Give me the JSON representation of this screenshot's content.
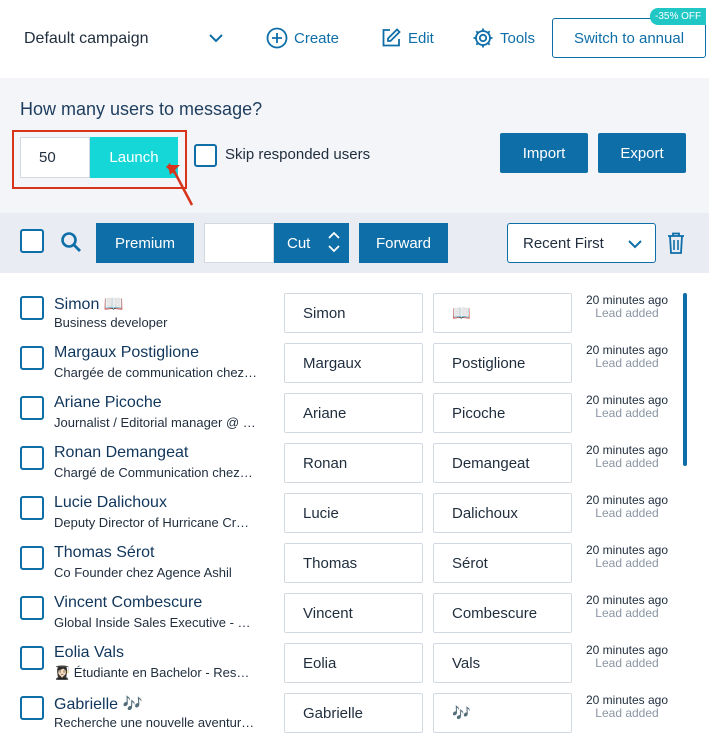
{
  "header": {
    "campaign": "Default campaign",
    "create_label": "Create",
    "edit_label": "Edit",
    "tools_label": "Tools",
    "switch_label": "Switch to annual",
    "discount_badge": "-35% OFF"
  },
  "launch": {
    "question": "How many users to message?",
    "count_value": "50",
    "launch_label": "Launch",
    "skip_label": "Skip responded users",
    "import_label": "Import",
    "export_label": "Export"
  },
  "toolbar": {
    "premium_label": "Premium",
    "cut_label": "Cut",
    "forward_label": "Forward",
    "sort_value": "Recent First"
  },
  "colors": {
    "primary": "#0e6ea8",
    "launch": "#15d7d8",
    "highlight": "#d8341b",
    "badge": "#20c7c4"
  },
  "leads": [
    {
      "name": "Simon 📖",
      "title": "Business developer",
      "first": "Simon",
      "last": "📖",
      "time": "20 minutes ago",
      "status": "Lead added"
    },
    {
      "name": "Margaux Postiglione",
      "title": "Chargée de communication chez…",
      "first": "Margaux",
      "last": "Postiglione",
      "time": "20 minutes ago",
      "status": "Lead added"
    },
    {
      "name": "Ariane Picoche",
      "title": "Journalist / Editorial manager @ …",
      "first": "Ariane",
      "last": "Picoche",
      "time": "20 minutes ago",
      "status": "Lead added"
    },
    {
      "name": "Ronan Demangeat",
      "title": "Chargé de Communication chez…",
      "first": "Ronan",
      "last": "Demangeat",
      "time": "20 minutes ago",
      "status": "Lead added"
    },
    {
      "name": "Lucie Dalichoux",
      "title": "Deputy Director of Hurricane Cr…",
      "first": "Lucie",
      "last": "Dalichoux",
      "time": "20 minutes ago",
      "status": "Lead added"
    },
    {
      "name": "Thomas Sérot",
      "title": "Co Founder chez Agence Ashil",
      "first": "Thomas",
      "last": "Sérot",
      "time": "20 minutes ago",
      "status": "Lead added"
    },
    {
      "name": "Vincent Combescure",
      "title": "Global Inside Sales Executive - …",
      "first": "Vincent",
      "last": "Combescure",
      "time": "20 minutes ago",
      "status": "Lead added"
    },
    {
      "name": "Eolia Vals",
      "title": "👩🏻‍🎓 Étudiante en Bachelor - Res…",
      "first": "Eolia",
      "last": "Vals",
      "time": "20 minutes ago",
      "status": "Lead added"
    },
    {
      "name": "Gabrielle 🎶",
      "title": "Recherche une nouvelle aventur…",
      "first": "Gabrielle",
      "last": "🎶",
      "time": "20 minutes ago",
      "status": "Lead added"
    }
  ]
}
